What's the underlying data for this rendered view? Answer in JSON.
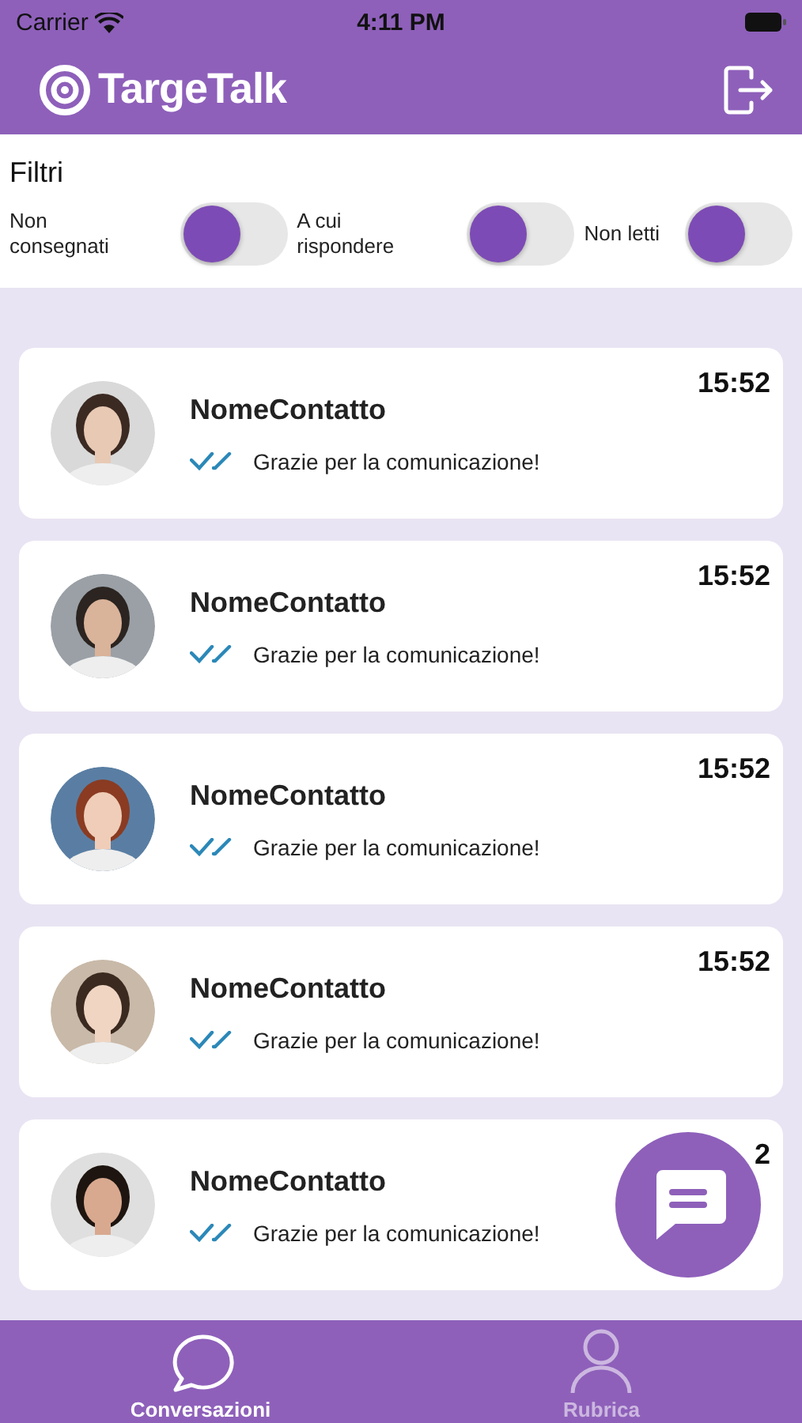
{
  "status_bar": {
    "carrier": "Carrier",
    "time": "4:11 PM"
  },
  "header": {
    "brand": "TargeTalk"
  },
  "filters": {
    "title": "Filtri",
    "toggles": [
      {
        "label": "Non consegnati",
        "on": false
      },
      {
        "label": "A cui rispondere",
        "on": false
      },
      {
        "label": "Non letti",
        "on": false
      }
    ]
  },
  "conversations": [
    {
      "name": "NomeContatto",
      "message": "Grazie per la comunicazione!",
      "time": "15:52"
    },
    {
      "name": "NomeContatto",
      "message": "Grazie per la comunicazione!",
      "time": "15:52"
    },
    {
      "name": "NomeContatto",
      "message": "Grazie per la comunicazione!",
      "time": "15:52"
    },
    {
      "name": "NomeContatto",
      "message": "Grazie per la comunicazione!",
      "time": "15:52"
    },
    {
      "name": "NomeContatto",
      "message": "Grazie per la comunicazione!",
      "time": "2"
    }
  ],
  "tab_bar": [
    {
      "label": "Conversazioni",
      "selected": true,
      "kind": "chat"
    },
    {
      "label": "Rubrica",
      "selected": false,
      "kind": "contact"
    }
  ]
}
